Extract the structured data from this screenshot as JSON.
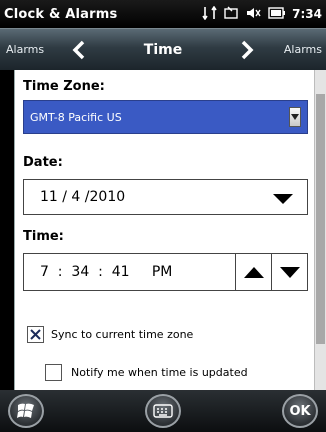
{
  "status": {
    "app_title": "Clock & Alarms",
    "time": "7:34"
  },
  "nav": {
    "prev_label": "Alarms",
    "title": "Time",
    "next_label": "Alarms"
  },
  "timezone": {
    "label": "Time Zone:",
    "value": "GMT-8 Pacific US"
  },
  "date": {
    "label": "Date:",
    "value": "11 / 4 /2010"
  },
  "time": {
    "label": "Time:",
    "value": "7  :  34  :  41     PM"
  },
  "options": {
    "sync_label": "Sync to current time zone",
    "sync_checked": true,
    "notify_label": "Notify me when time is updated",
    "notify_checked": false
  },
  "bottom": {
    "ok_label": "OK"
  },
  "colors": {
    "selection": "#3a5ac4",
    "background": "#ffffff"
  }
}
